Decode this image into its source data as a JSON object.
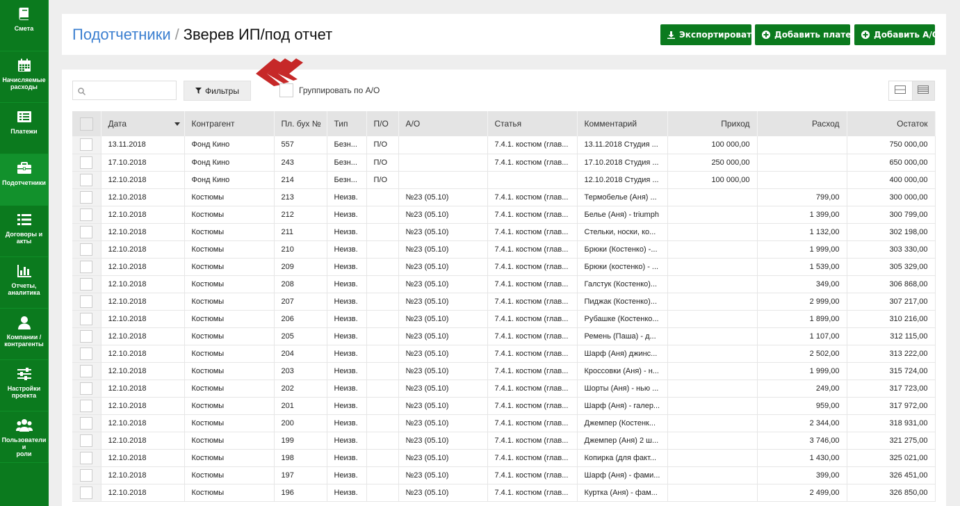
{
  "sidebar": {
    "items": [
      {
        "label": "Смета",
        "icon": "book-icon"
      },
      {
        "label": "Начисляемые\nрасходы",
        "icon": "calendar-icon"
      },
      {
        "label": "Платежи",
        "icon": "list-icon"
      },
      {
        "label": "Подотчетники",
        "icon": "briefcase-icon"
      },
      {
        "label": "Договоры и\nакты",
        "icon": "document-list-icon"
      },
      {
        "label": "Отчеты,\nаналитика",
        "icon": "bar-chart-icon"
      },
      {
        "label": "Компании /\nконтрагенты",
        "icon": "user-icon"
      },
      {
        "label": "Настройки\nпроекта",
        "icon": "sliders-icon"
      },
      {
        "label": "Пользователи и\nроли",
        "icon": "users-icon"
      }
    ],
    "active_index": 3
  },
  "header": {
    "crumb_link": "Подотчетники",
    "crumb_sep": "/",
    "crumb_current": "Зверев ИП/под отчет",
    "export_label": "Экспортировать",
    "add_payment_label": "Добавить платеж",
    "add_ao_label": "Добавить А/О"
  },
  "toolbar": {
    "search_value": "",
    "search_placeholder": "",
    "filter_label": "Фильтры",
    "group_label": "Группировать по А/О"
  },
  "colors": {
    "sidebar": "#0b7a1e",
    "accent_button": "#0b7a1e",
    "link": "#3b7fd0",
    "marker": "#c62828"
  },
  "table": {
    "columns": [
      "Дата",
      "Контрагент",
      "Пл. бух №",
      "Тип",
      "П/О",
      "А/О",
      "Статья",
      "Комментарий",
      "Приход",
      "Расход",
      "Остаток"
    ],
    "rows": [
      [
        "13.11.2018",
        "Фонд Кино",
        "557",
        "Безн...",
        "П/О",
        "",
        "7.4.1. костюм (глав...",
        "13.11.2018 Студия ...",
        "100 000,00",
        "",
        "750 000,00"
      ],
      [
        "17.10.2018",
        "Фонд Кино",
        "243",
        "Безн...",
        "П/О",
        "",
        "7.4.1. костюм (глав...",
        "17.10.2018 Студия ...",
        "250 000,00",
        "",
        "650 000,00"
      ],
      [
        "12.10.2018",
        "Фонд Кино",
        "214",
        "Безн...",
        "П/О",
        "",
        "",
        "12.10.2018 Студия ...",
        "100 000,00",
        "",
        "400 000,00"
      ],
      [
        "12.10.2018",
        "Костюмы",
        "213",
        "Неизв.",
        "",
        "№23 (05.10)",
        "7.4.1. костюм (глав...",
        "Термобелье (Аня) ...",
        "",
        "799,00",
        "300 000,00"
      ],
      [
        "12.10.2018",
        "Костюмы",
        "212",
        "Неизв.",
        "",
        "№23 (05.10)",
        "7.4.1. костюм (глав...",
        "Белье (Аня) - triumph",
        "",
        "1 399,00",
        "300 799,00"
      ],
      [
        "12.10.2018",
        "Костюмы",
        "211",
        "Неизв.",
        "",
        "№23 (05.10)",
        "7.4.1. костюм (глав...",
        "Стельки, носки, ко...",
        "",
        "1 132,00",
        "302 198,00"
      ],
      [
        "12.10.2018",
        "Костюмы",
        "210",
        "Неизв.",
        "",
        "№23 (05.10)",
        "7.4.1. костюм (глав...",
        "Брюки (Костенко) -...",
        "",
        "1 999,00",
        "303 330,00"
      ],
      [
        "12.10.2018",
        "Костюмы",
        "209",
        "Неизв.",
        "",
        "№23 (05.10)",
        "7.4.1. костюм (глав...",
        "Брюки (костенко) - ...",
        "",
        "1 539,00",
        "305 329,00"
      ],
      [
        "12.10.2018",
        "Костюмы",
        "208",
        "Неизв.",
        "",
        "№23 (05.10)",
        "7.4.1. костюм (глав...",
        "Галстук (Костенко)...",
        "",
        "349,00",
        "306 868,00"
      ],
      [
        "12.10.2018",
        "Костюмы",
        "207",
        "Неизв.",
        "",
        "№23 (05.10)",
        "7.4.1. костюм (глав...",
        "Пиджак (Костенко)...",
        "",
        "2 999,00",
        "307 217,00"
      ],
      [
        "12.10.2018",
        "Костюмы",
        "206",
        "Неизв.",
        "",
        "№23 (05.10)",
        "7.4.1. костюм (глав...",
        "Рубашке (Костенко...",
        "",
        "1 899,00",
        "310 216,00"
      ],
      [
        "12.10.2018",
        "Костюмы",
        "205",
        "Неизв.",
        "",
        "№23 (05.10)",
        "7.4.1. костюм (глав...",
        "Ремень (Паша) - д...",
        "",
        "1 107,00",
        "312 115,00"
      ],
      [
        "12.10.2018",
        "Костюмы",
        "204",
        "Неизв.",
        "",
        "№23 (05.10)",
        "7.4.1. костюм (глав...",
        "Шарф (Аня) джинс...",
        "",
        "2 502,00",
        "313 222,00"
      ],
      [
        "12.10.2018",
        "Костюмы",
        "203",
        "Неизв.",
        "",
        "№23 (05.10)",
        "7.4.1. костюм (глав...",
        "Кроссовки (Аня) - н...",
        "",
        "1 999,00",
        "315 724,00"
      ],
      [
        "12.10.2018",
        "Костюмы",
        "202",
        "Неизв.",
        "",
        "№23 (05.10)",
        "7.4.1. костюм (глав...",
        "Шорты (Аня) - нью ...",
        "",
        "249,00",
        "317 723,00"
      ],
      [
        "12.10.2018",
        "Костюмы",
        "201",
        "Неизв.",
        "",
        "№23 (05.10)",
        "7.4.1. костюм (глав...",
        "Шарф (Аня) - галер...",
        "",
        "959,00",
        "317 972,00"
      ],
      [
        "12.10.2018",
        "Костюмы",
        "200",
        "Неизв.",
        "",
        "№23 (05.10)",
        "7.4.1. костюм (глав...",
        "Джемпер (Костенк...",
        "",
        "2 344,00",
        "318 931,00"
      ],
      [
        "12.10.2018",
        "Костюмы",
        "199",
        "Неизв.",
        "",
        "№23 (05.10)",
        "7.4.1. костюм (глав...",
        "Джемпер (Аня) 2 ш...",
        "",
        "3 746,00",
        "321 275,00"
      ],
      [
        "12.10.2018",
        "Костюмы",
        "198",
        "Неизв.",
        "",
        "№23 (05.10)",
        "7.4.1. костюм (глав...",
        "Копирка (для факт...",
        "",
        "1 430,00",
        "325 021,00"
      ],
      [
        "12.10.2018",
        "Костюмы",
        "197",
        "Неизв.",
        "",
        "№23 (05.10)",
        "7.4.1. костюм (глав...",
        "Шарф (Аня) - фами...",
        "",
        "399,00",
        "326 451,00"
      ],
      [
        "12.10.2018",
        "Костюмы",
        "196",
        "Неизв.",
        "",
        "№23 (05.10)",
        "7.4.1. костюм (глав...",
        "Куртка (Аня) - фам...",
        "",
        "2 499,00",
        "326 850,00"
      ]
    ]
  }
}
